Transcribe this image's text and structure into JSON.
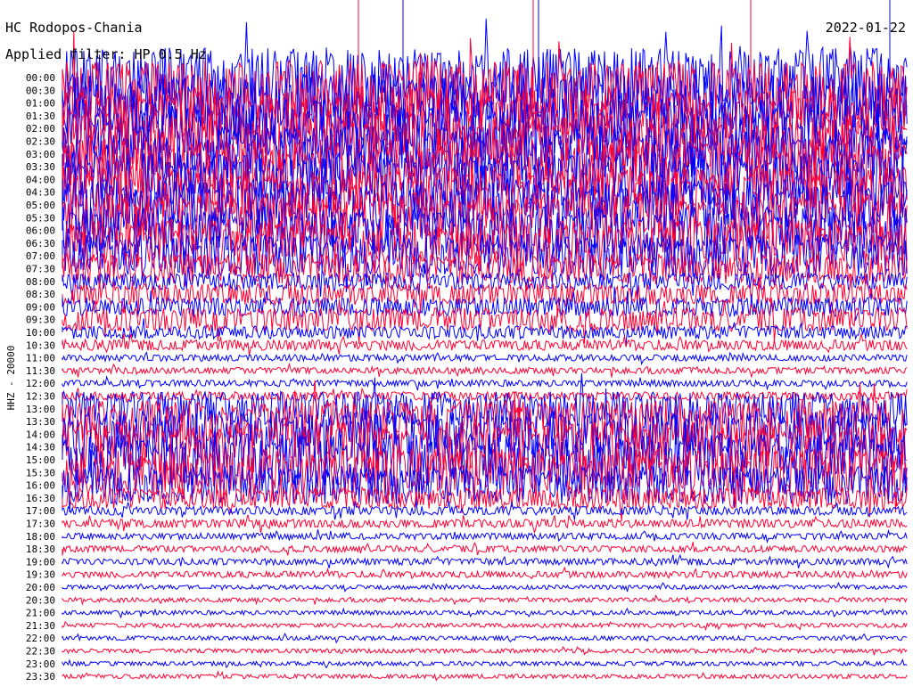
{
  "chart_data": {
    "type": "line",
    "title": "HC Rodopos-Chania",
    "subtitle": "Applied filter: HP 0.5 Hz",
    "date": "2022-01-22",
    "ylabel": "HHZ - 20000",
    "tick_labels": [
      "00:00",
      "00:30",
      "01:00",
      "01:30",
      "02:00",
      "02:30",
      "03:00",
      "03:30",
      "04:00",
      "04:30",
      "05:00",
      "05:30",
      "06:00",
      "06:30",
      "07:00",
      "07:30",
      "08:00",
      "08:30",
      "09:00",
      "09:30",
      "10:00",
      "10:30",
      "11:00",
      "11:30",
      "12:00",
      "12:30",
      "13:00",
      "13:30",
      "14:00",
      "14:30",
      "15:00",
      "15:30",
      "16:00",
      "16:30",
      "17:00",
      "17:30",
      "18:00",
      "18:30",
      "19:00",
      "19:30",
      "20:00",
      "20:30",
      "21:00",
      "21:30",
      "22:00",
      "22:30",
      "23:00",
      "23:30"
    ],
    "trace_colors": [
      "#0000ff",
      "#ff0033"
    ],
    "trace_amplitude": [
      28,
      28,
      28,
      28,
      28,
      28,
      26,
      26,
      26,
      24,
      24,
      24,
      22,
      22,
      20,
      14,
      8,
      10,
      9,
      11,
      6,
      5,
      3,
      3,
      3,
      4,
      16,
      20,
      22,
      24,
      24,
      22,
      18,
      10,
      4,
      4,
      3,
      3,
      3,
      3,
      2,
      2,
      2,
      2,
      2,
      2,
      2,
      2
    ],
    "spikes_present": true,
    "grid": false,
    "legend": "none"
  }
}
